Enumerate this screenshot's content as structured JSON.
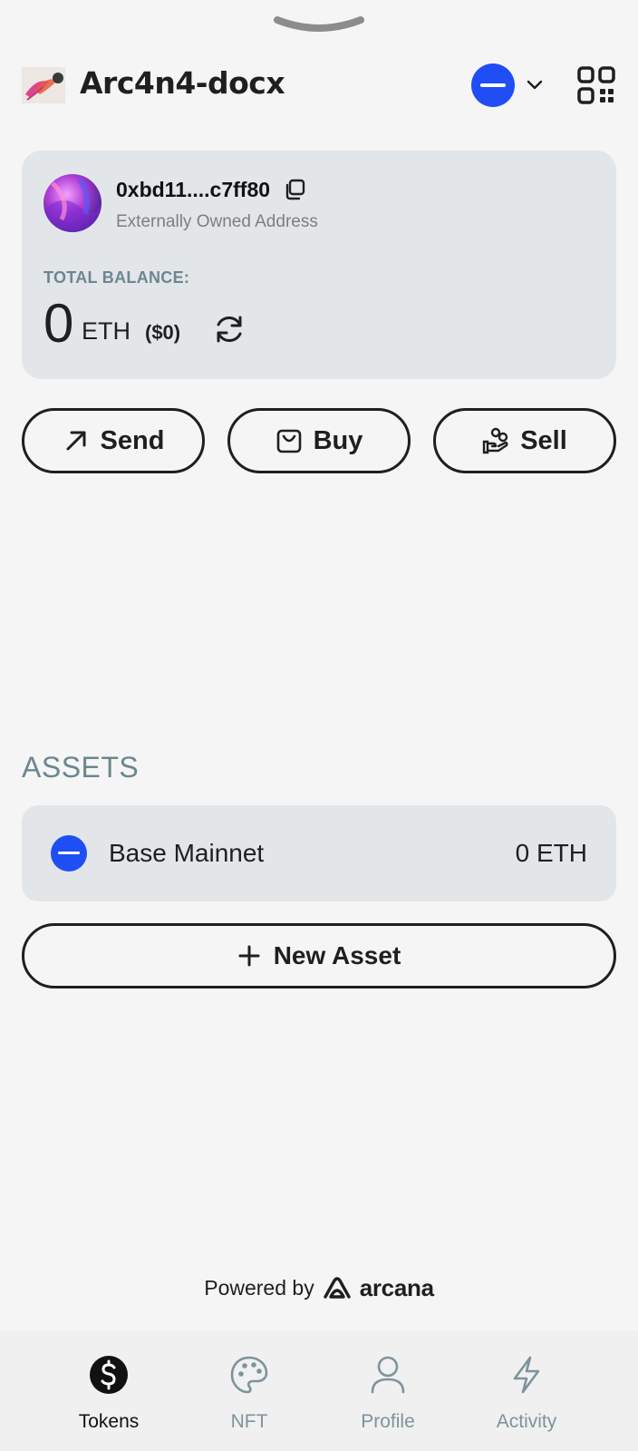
{
  "header": {
    "app_name": "Arc4n4-docx"
  },
  "account": {
    "address": "0xbd11....c7ff80",
    "address_type": "Externally Owned Address",
    "balance_label": "TOTAL BALANCE:",
    "balance_value": "0",
    "balance_unit": "ETH",
    "balance_usd": "($0)"
  },
  "actions": {
    "send_label": "Send",
    "buy_label": "Buy",
    "sell_label": "Sell"
  },
  "assets": {
    "title": "ASSETS",
    "items": [
      {
        "name": "Base Mainnet",
        "balance": "0 ETH"
      }
    ],
    "new_asset_label": "New Asset"
  },
  "footer": {
    "powered_by": "Powered by",
    "brand": "arcana"
  },
  "tabs": [
    {
      "label": "Tokens",
      "active": true,
      "icon": "dollar-icon"
    },
    {
      "label": "NFT",
      "active": false,
      "icon": "palette-icon"
    },
    {
      "label": "Profile",
      "active": false,
      "icon": "user-icon"
    },
    {
      "label": "Activity",
      "active": false,
      "icon": "lightning-icon"
    }
  ],
  "colors": {
    "chain_blue": "#1f4ef5",
    "card_bg": "#e2e6e8",
    "muted_label": "#6d8690"
  }
}
